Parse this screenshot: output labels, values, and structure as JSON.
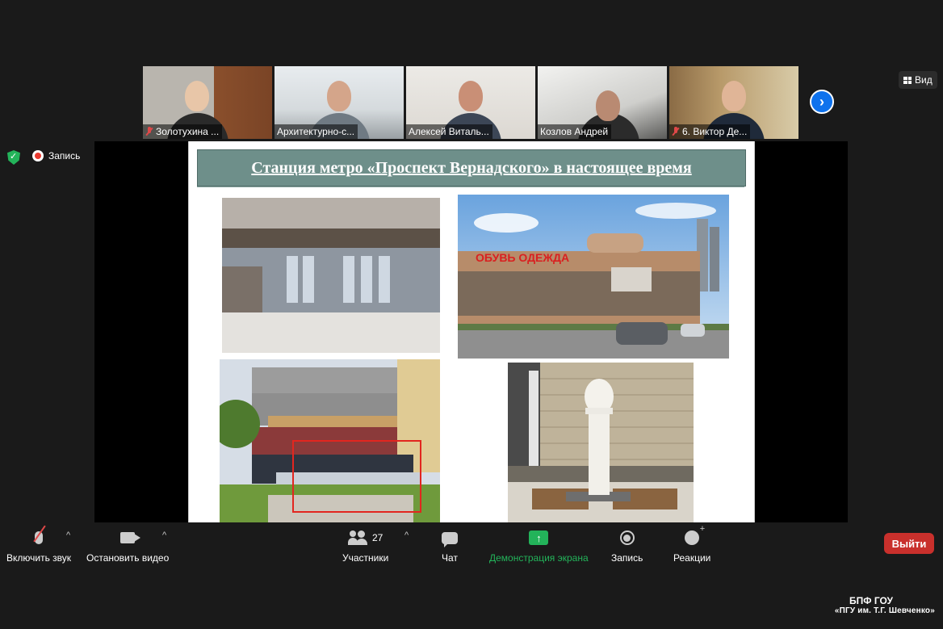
{
  "participants_strip": {
    "tiles": [
      {
        "name": "Золотухина ...",
        "muted": true
      },
      {
        "name": "Архитектурно-с...",
        "muted": false
      },
      {
        "name": "Алексей Виталь...",
        "muted": false,
        "active_speaker": true
      },
      {
        "name": "Козлов Андрей",
        "muted": false
      },
      {
        "name": "6. Виктор Де...",
        "muted": true
      }
    ],
    "next_icon": "chevron-right-icon"
  },
  "view_button": {
    "label": "Вид",
    "icon": "grid-icon"
  },
  "status": {
    "security_icon": "shield-icon",
    "recording_label": "Запись"
  },
  "slide": {
    "title": "Станция метро «Проспект Вернадского» в настоящее время",
    "photos": [
      {
        "subject": "metro-entrance-photo"
      },
      {
        "subject": "shopping-center-photo",
        "signage": "ОБУВЬ ОДЕЖДА"
      },
      {
        "subject": "construction-site-photo"
      },
      {
        "subject": "bust-monument-photo"
      }
    ]
  },
  "toolbar": {
    "unmute_label": "Включить звук",
    "stop_video_label": "Остановить видео",
    "participants_label": "Участники",
    "participants_count": "27",
    "chat_label": "Чат",
    "share_label": "Демонстрация экрана",
    "record_label": "Запись",
    "reactions_label": "Реакции",
    "leave_label": "Выйти"
  },
  "watermark": {
    "line1": "БПФ ГОУ",
    "line2": "«ПГУ им. Т.Г. Шевченко»"
  },
  "colors": {
    "background": "#1a1a1a",
    "share_green": "#23b35a",
    "leave_red": "#c9302c",
    "next_blue": "#0e72ed",
    "slide_title_bg": "#6e8f8a"
  }
}
